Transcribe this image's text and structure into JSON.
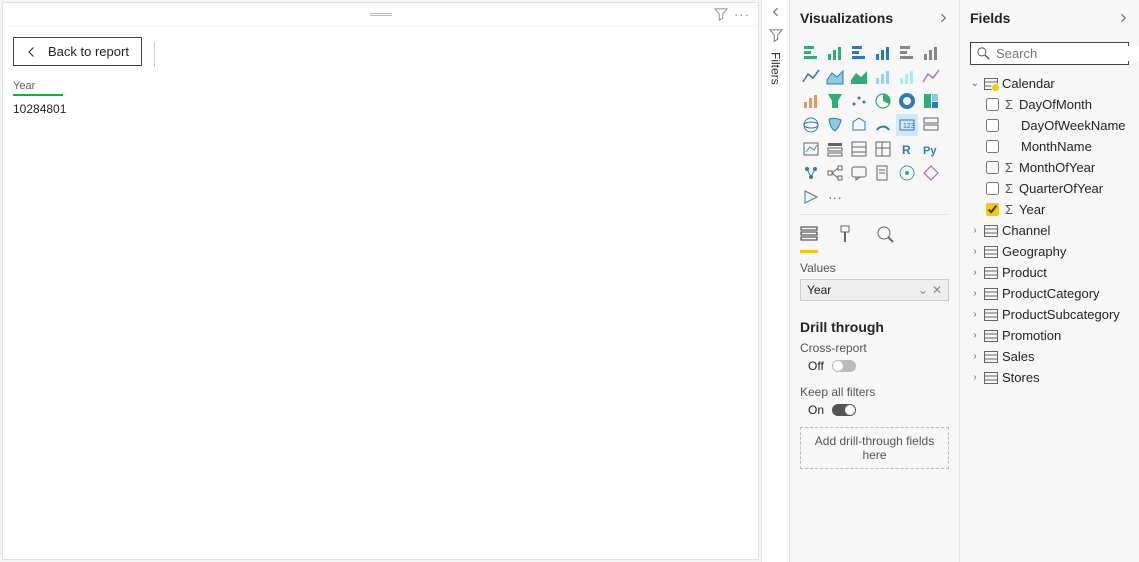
{
  "canvas": {
    "back_label": "Back to report",
    "visual": {
      "label": "Year",
      "value": "10284801"
    }
  },
  "filters_tab": {
    "label": "Filters"
  },
  "visualizations": {
    "title": "Visualizations",
    "icons": [
      "stacked-bar",
      "stacked-column",
      "clustered-bar",
      "clustered-column",
      "100-stacked-bar",
      "100-stacked-column",
      "line",
      "area",
      "stacked-area",
      "line-stacked-column",
      "line-clustered-column",
      "ribbon",
      "waterfall",
      "funnel",
      "scatter",
      "pie",
      "donut",
      "treemap",
      "map",
      "filled-map",
      "shape-map",
      "gauge",
      "card",
      "multi-row-card",
      "kpi",
      "slicer",
      "table",
      "matrix",
      "r-visual",
      "python-visual",
      "key-influencers",
      "decomposition-tree",
      "qna",
      "paginated",
      "arcgis",
      "power-apps",
      "power-automate",
      "more"
    ],
    "selected_icon": "card",
    "tabs": {
      "fields": "fields",
      "format": "format",
      "analytics": "analytics"
    },
    "values_label": "Values",
    "values_chip": "Year",
    "drillthrough": {
      "title": "Drill through",
      "cross_report_label": "Cross-report",
      "cross_report_state": "Off",
      "keep_filters_label": "Keep all filters",
      "keep_filters_state": "On",
      "drop_hint": "Add drill-through fields here"
    }
  },
  "fields": {
    "title": "Fields",
    "search_placeholder": "Search",
    "tables": [
      {
        "name": "Calendar",
        "expanded": true,
        "has_selection": true,
        "columns": [
          {
            "name": "DayOfMonth",
            "numeric": true,
            "checked": false
          },
          {
            "name": "DayOfWeekName",
            "numeric": false,
            "checked": false
          },
          {
            "name": "MonthName",
            "numeric": false,
            "checked": false
          },
          {
            "name": "MonthOfYear",
            "numeric": true,
            "checked": false
          },
          {
            "name": "QuarterOfYear",
            "numeric": true,
            "checked": false
          },
          {
            "name": "Year",
            "numeric": true,
            "checked": true
          }
        ]
      },
      {
        "name": "Channel",
        "expanded": false
      },
      {
        "name": "Geography",
        "expanded": false
      },
      {
        "name": "Product",
        "expanded": false
      },
      {
        "name": "ProductCategory",
        "expanded": false
      },
      {
        "name": "ProductSubcategory",
        "expanded": false
      },
      {
        "name": "Promotion",
        "expanded": false
      },
      {
        "name": "Sales",
        "expanded": false
      },
      {
        "name": "Stores",
        "expanded": false
      }
    ]
  }
}
